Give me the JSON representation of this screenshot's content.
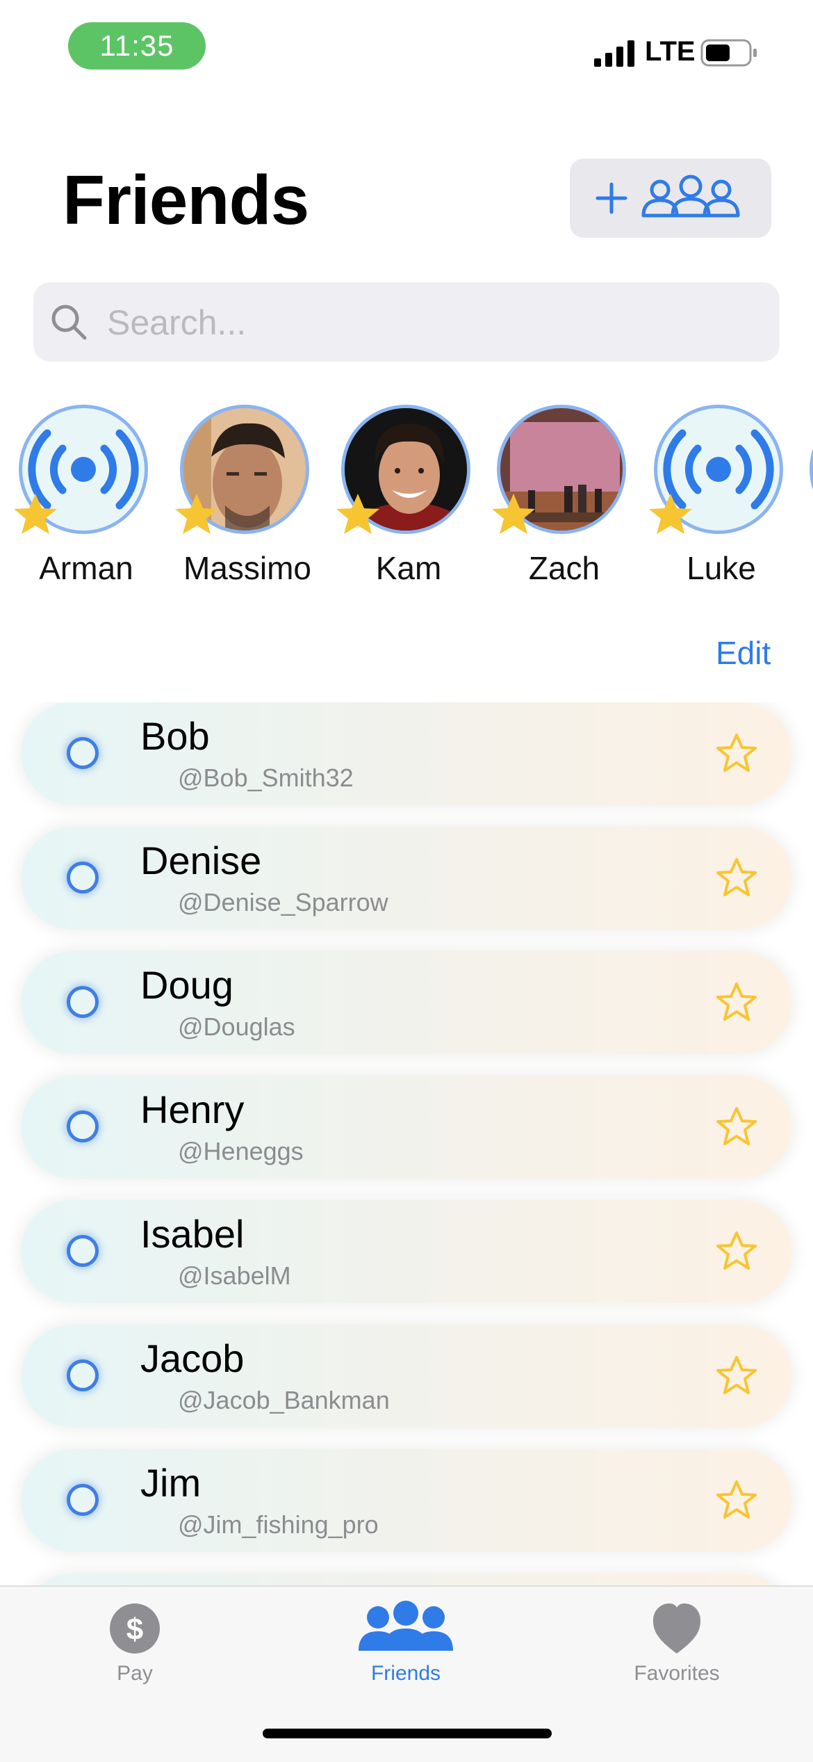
{
  "status_bar": {
    "time": "11:35",
    "network": "LTE"
  },
  "header": {
    "title": "Friends",
    "add_icon": "plus-icon",
    "group_icon": "people-group-icon"
  },
  "search": {
    "placeholder": "Search...",
    "icon": "magnifier-icon"
  },
  "favorites": [
    {
      "name": "Arman",
      "avatar": "broadcast-icon"
    },
    {
      "name": "Massimo",
      "avatar": "photo"
    },
    {
      "name": "Kam",
      "avatar": "photo"
    },
    {
      "name": "Zach",
      "avatar": "photo"
    },
    {
      "name": "Luke",
      "avatar": "broadcast-icon"
    }
  ],
  "edit_label": "Edit",
  "friends": [
    {
      "name": "Bob",
      "handle": "@Bob_Smith32"
    },
    {
      "name": "Denise",
      "handle": "@Denise_Sparrow"
    },
    {
      "name": "Doug",
      "handle": "@Douglas"
    },
    {
      "name": "Henry",
      "handle": "@Heneggs"
    },
    {
      "name": "Isabel",
      "handle": "@IsabelM"
    },
    {
      "name": "Jacob",
      "handle": "@Jacob_Bankman"
    },
    {
      "name": "Jim",
      "handle": "@Jim_fishing_pro"
    }
  ],
  "tabs": [
    {
      "label": "Pay",
      "icon": "dollar-circle-icon",
      "active": false
    },
    {
      "label": "Friends",
      "icon": "people-group-icon",
      "active": true
    },
    {
      "label": "Favorites",
      "icon": "heart-icon",
      "active": false
    }
  ],
  "colors": {
    "accent": "#2f7be8",
    "time_pill": "#5dc466",
    "star": "#f7c531",
    "inactive_tab": "#8e8e93"
  }
}
